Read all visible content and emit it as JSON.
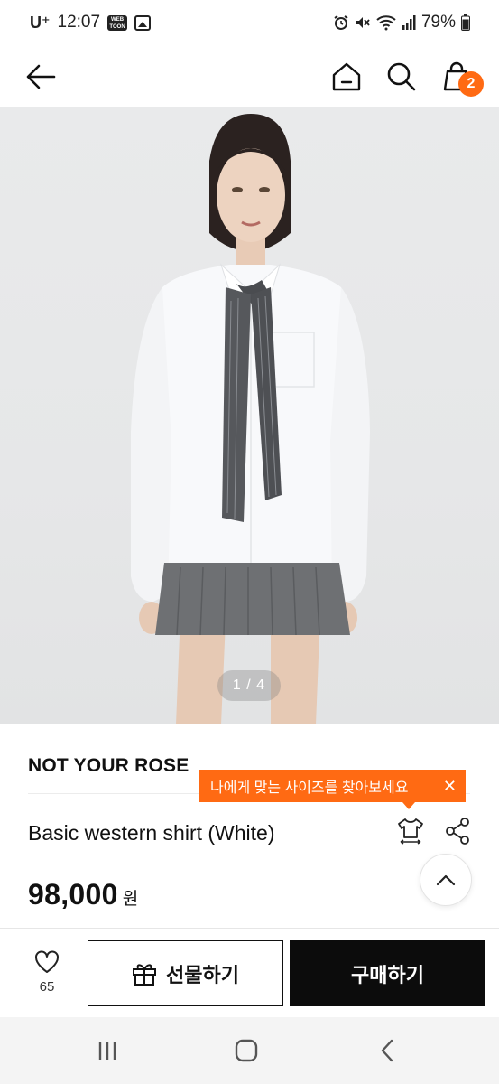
{
  "status_bar": {
    "carrier": "U⁺",
    "time": "12:07",
    "mini_app_label": "WEB TOON",
    "battery": "79%",
    "icons": [
      "alarm-icon",
      "mute-icon",
      "wifi-icon",
      "signal-icon",
      "battery-icon"
    ]
  },
  "header": {
    "icons": [
      "back-arrow-icon",
      "home-icon",
      "search-icon",
      "cart-icon"
    ],
    "cart_count": "2"
  },
  "gallery": {
    "counter": "1 / 4"
  },
  "product": {
    "brand": "NOT YOUR ROSE",
    "name": "Basic western shirt (White)",
    "price": "98,000",
    "currency": "원"
  },
  "size_tooltip": {
    "text": "나에게 맞는 사이즈를 찾아보세요",
    "close": "✕"
  },
  "actions": {
    "like_count": "65",
    "gift_label": "선물하기",
    "buy_label": "구매하기"
  },
  "colors": {
    "accent": "#ff6a13",
    "buy_button": "#0c0c0c",
    "background": "#ffffff"
  }
}
